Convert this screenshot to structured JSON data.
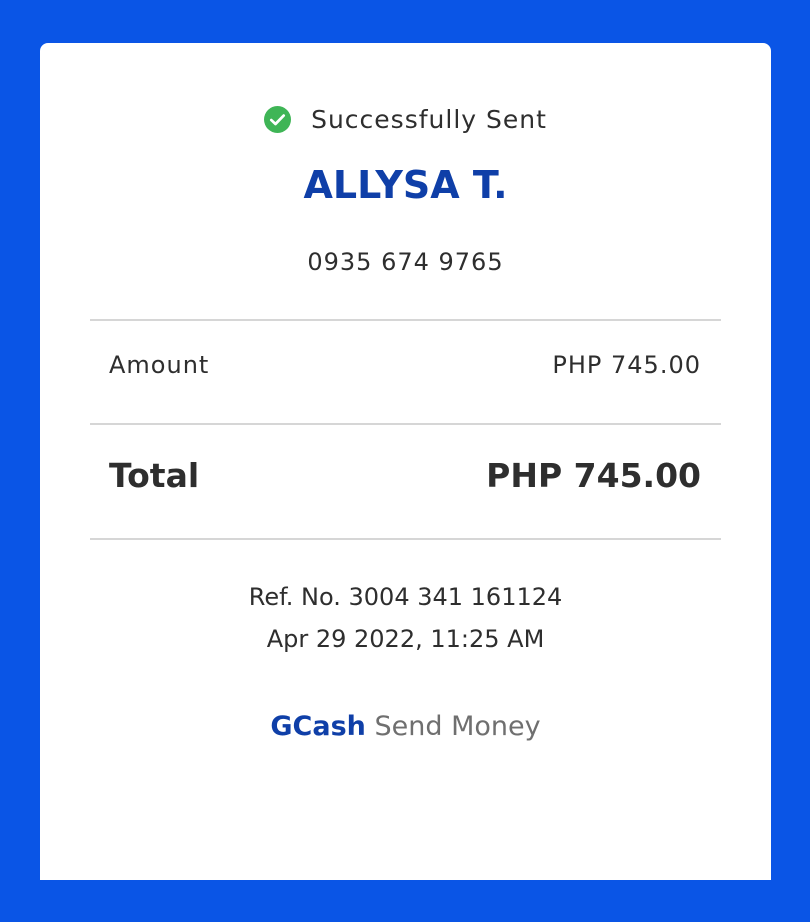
{
  "status": {
    "text": "Successfully Sent",
    "icon": "check-circle-icon",
    "icon_color": "#3fb556"
  },
  "recipient": {
    "name": "ALLYSA T.",
    "phone": "0935 674 9765"
  },
  "amount": {
    "label": "Amount",
    "value": "PHP 745.00"
  },
  "total": {
    "label": "Total",
    "value": "PHP 745.00"
  },
  "transaction": {
    "ref_no": "Ref. No. 3004 341 161124",
    "datetime": "Apr 29 2022, 11:25 AM"
  },
  "brand": {
    "name": "GCash",
    "service": "Send Money"
  },
  "colors": {
    "background": "#0a55e6",
    "accent": "#0f3fa8",
    "card": "#ffffff"
  }
}
